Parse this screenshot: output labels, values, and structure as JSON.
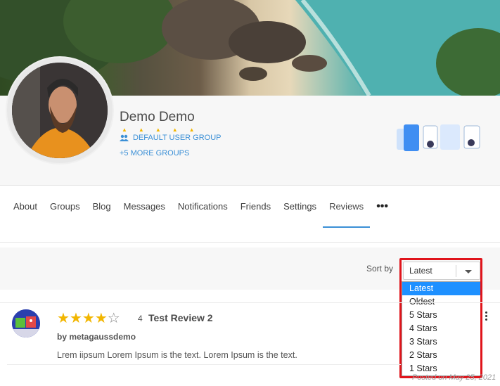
{
  "profile": {
    "name": "Demo Demo",
    "group": "DEFAULT USER GROUP",
    "more_groups": "+5 MORE GROUPS"
  },
  "tabs": [
    "About",
    "Groups",
    "Blog",
    "Messages",
    "Notifications",
    "Friends",
    "Settings",
    "Reviews"
  ],
  "active_tab": "Reviews",
  "sort": {
    "label": "Sort by",
    "selected": "Latest",
    "options": [
      "Latest",
      "Oldest",
      "5 Stars",
      "4 Stars",
      "3 Stars",
      "2 Stars",
      "1 Stars"
    ]
  },
  "review": {
    "rating": 4,
    "rating_text": "4",
    "title": "Test Review 2",
    "author": "by metagaussdemo",
    "body": "Lrem iipsum Lorem Ipsum is the text. Lorem Ipsum is the text.",
    "posted": "Posted on May 25, 2021"
  },
  "colors": {
    "accent": "#3a8fd6",
    "star": "#f2b600",
    "highlight": "#e0141b",
    "selected_option": "#1e90ff"
  }
}
